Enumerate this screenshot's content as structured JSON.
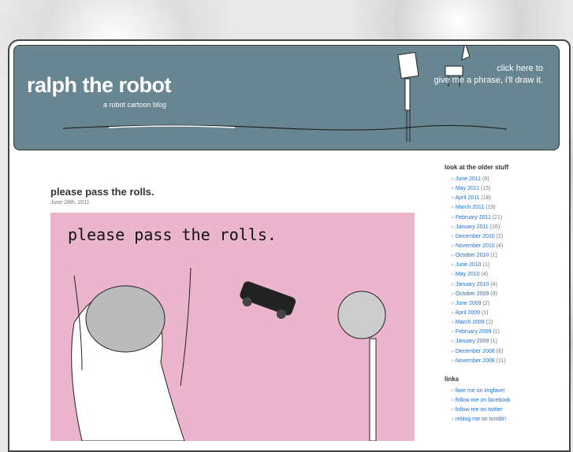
{
  "header": {
    "title": "ralph the robot",
    "tagline": "a robot cartoon blog",
    "cta_line1": "click here to",
    "cta_line2": "give me a phrase, i'll draw it."
  },
  "post": {
    "title": "please pass the rolls.",
    "date": "June 28th, 2011",
    "comic_text": "please pass the rolls."
  },
  "sidebar": {
    "archive_heading": "look at the older stuff",
    "archive": [
      {
        "label": "June 2011",
        "count": "(9)"
      },
      {
        "label": "May 2011",
        "count": "(15)"
      },
      {
        "label": "April 2011",
        "count": "(18)"
      },
      {
        "label": "March 2011",
        "count": "(19)"
      },
      {
        "label": "February 2011",
        "count": "(21)"
      },
      {
        "label": "January 2011",
        "count": "(16)"
      },
      {
        "label": "December 2010",
        "count": "(2)"
      },
      {
        "label": "November 2010",
        "count": "(4)"
      },
      {
        "label": "October 2010",
        "count": "(1)"
      },
      {
        "label": "June 2010",
        "count": "(1)"
      },
      {
        "label": "May 2010",
        "count": "(4)"
      },
      {
        "label": "January 2010",
        "count": "(4)"
      },
      {
        "label": "October 2009",
        "count": "(3)"
      },
      {
        "label": "June 2009",
        "count": "(2)"
      },
      {
        "label": "April 2009",
        "count": "(1)"
      },
      {
        "label": "March 2009",
        "count": "(2)"
      },
      {
        "label": "February 2009",
        "count": "(1)"
      },
      {
        "label": "January 2009",
        "count": "(1)"
      },
      {
        "label": "December 2008",
        "count": "(8)"
      },
      {
        "label": "November 2008",
        "count": "(11)"
      }
    ],
    "links_heading": "links",
    "links": [
      {
        "label": "fave me on imgfave!"
      },
      {
        "label": "follow me on facebook"
      },
      {
        "label": "follow me on twitter"
      },
      {
        "label": "reblog me on tumblr!"
      }
    ]
  }
}
